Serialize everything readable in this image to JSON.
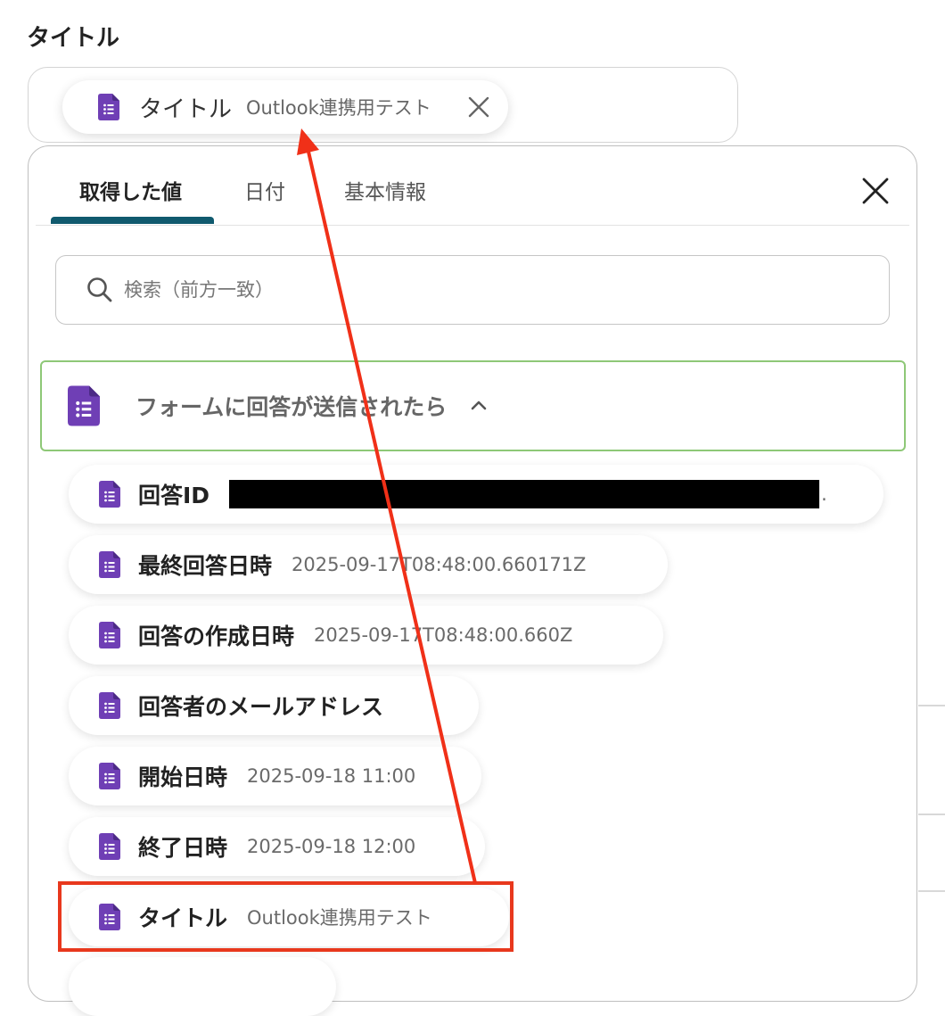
{
  "field": {
    "label": "タイトル",
    "chip": {
      "key": "タイトル",
      "value": "Outlook連携用テスト"
    }
  },
  "panel": {
    "tabs": [
      {
        "label": "取得した値",
        "active": true
      },
      {
        "label": "日付",
        "active": false
      },
      {
        "label": "基本情報",
        "active": false
      }
    ],
    "search": {
      "placeholder": "検索（前方一致）",
      "value": ""
    },
    "group": {
      "label": "フォームに回答が送信されたら",
      "expanded": true,
      "border_color": "#8ec877"
    },
    "items": [
      {
        "key": "回答ID",
        "value": "",
        "redacted": true,
        "suffix": "."
      },
      {
        "key": "最終回答日時",
        "value": "2025-09-17T08:48:00.660171Z"
      },
      {
        "key": "回答の作成日時",
        "value": "2025-09-17T08:48:00.660Z"
      },
      {
        "key": "回答者のメールアドレス",
        "value": ""
      },
      {
        "key": "開始日時",
        "value": "2025-09-18 11:00"
      },
      {
        "key": "終了日時",
        "value": "2025-09-18 12:00"
      },
      {
        "key": "タイトル",
        "value": "Outlook連携用テスト",
        "highlighted": true
      }
    ]
  },
  "icons": {
    "item_icon": "google-forms-icon",
    "search": "search-icon",
    "close": "close-icon",
    "chevron": "chevron-up-icon"
  },
  "colors": {
    "tab_underline": "#105a6e",
    "forms_icon": "#6f3fb5",
    "annotation_red": "#e8381d"
  }
}
